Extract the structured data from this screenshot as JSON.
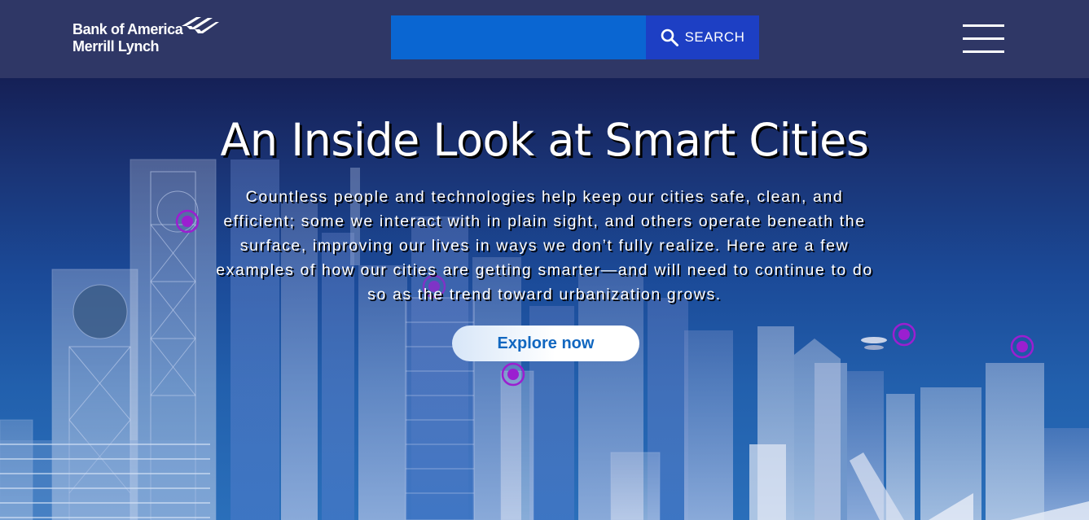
{
  "header": {
    "logo": {
      "line1": "Bank of America",
      "line2": "Merrill Lynch",
      "flag_icon": "flag-icon"
    },
    "search": {
      "placeholder": "",
      "value": "",
      "button_label": "SEARCH",
      "icon": "search-icon"
    },
    "menu_icon": "hamburger-menu-icon"
  },
  "hero": {
    "title": "An Inside Look at Smart Cities",
    "description": "Countless people and technologies help keep our cities safe, clean, and efficient; some we interact with in plain sight, and others operate beneath the surface, improving our lives in ways we don’t fully realize. Here are a few examples of how our cities are getting smarter—and will need to continue to do so as the trend toward urbanization grows.",
    "cta_label": "Explore now"
  },
  "colors": {
    "header_bg": "#2f3766",
    "search_input": "#0a66d2",
    "search_button": "#1d3fc4",
    "hero_top": "#152056",
    "hero_bottom": "#2a6fba",
    "cta_text": "#1167c0",
    "marker": "#9b1fd0"
  }
}
